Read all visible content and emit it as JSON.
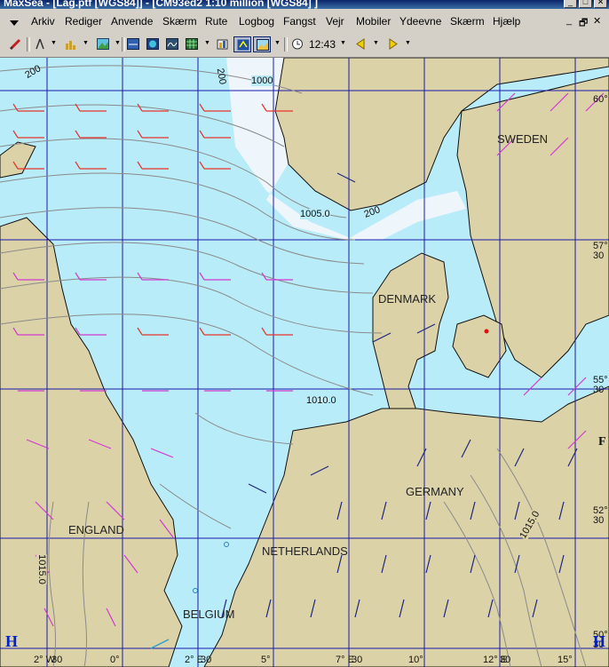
{
  "window": {
    "title": "MaxSea - [Lag.ptf [WGS84]] - [CM93ed2  1:10 million [WGS84] ]",
    "controls": [
      "minimize",
      "maximize",
      "close"
    ]
  },
  "menu": {
    "items": [
      "Arkiv",
      "Rediger",
      "Anvende",
      "Skærm",
      "Rute",
      "Logbog",
      "Fangst",
      "Vejr",
      "Mobiler",
      "Ydeevne",
      "Skærm",
      "Hjælp"
    ],
    "mdi_controls": [
      "_",
      "🗗",
      "✕"
    ]
  },
  "toolbar": {
    "clock": "12:43",
    "icons": [
      "pencil-icon",
      "compass-tool-icon",
      "chart-tool-icon",
      "map-picture-icon",
      "layer-icon",
      "globe-icon",
      "weather-icon",
      "grid-icon",
      "chart-db-icon",
      "rotate-icon",
      "overlay-icon",
      "clock-icon",
      "arrow-left-icon",
      "arrow-right-icon"
    ]
  },
  "map": {
    "countries": [
      "SWEDEN",
      "DENMARK",
      "GERMANY",
      "ENGLAND",
      "NETHERLANDS",
      "BELGIUM"
    ],
    "isobars": [
      "1000",
      "1005.0",
      "1010.0",
      "1015.0",
      "1015.0"
    ],
    "depth_labels": [
      "200",
      "200",
      "200"
    ],
    "pressure_centers": [
      "H",
      "H",
      "H"
    ],
    "lat_labels": [
      {
        "deg": "60°",
        "min": ""
      },
      {
        "deg": "57°",
        "min": "30"
      },
      {
        "deg": "55°",
        "min": "30"
      },
      {
        "deg": "52°",
        "min": "30"
      },
      {
        "deg": "50°",
        "min": "30"
      }
    ],
    "lon_labels": [
      "2° W",
      "30",
      "0°",
      "2° E",
      "30",
      "5°",
      "7° E",
      "30",
      "10°",
      "12° E",
      "30",
      "15°"
    ],
    "partial_labels": [
      "F",
      "F"
    ],
    "colors": {
      "sea": "#b8ecf8",
      "land": "#dcd2a8",
      "ice": "#eef6fb",
      "grid": "#1a1aa8",
      "wind_red": "#e8332a",
      "wind_magenta": "#d23ad2",
      "wind_navy": "#202880"
    }
  }
}
